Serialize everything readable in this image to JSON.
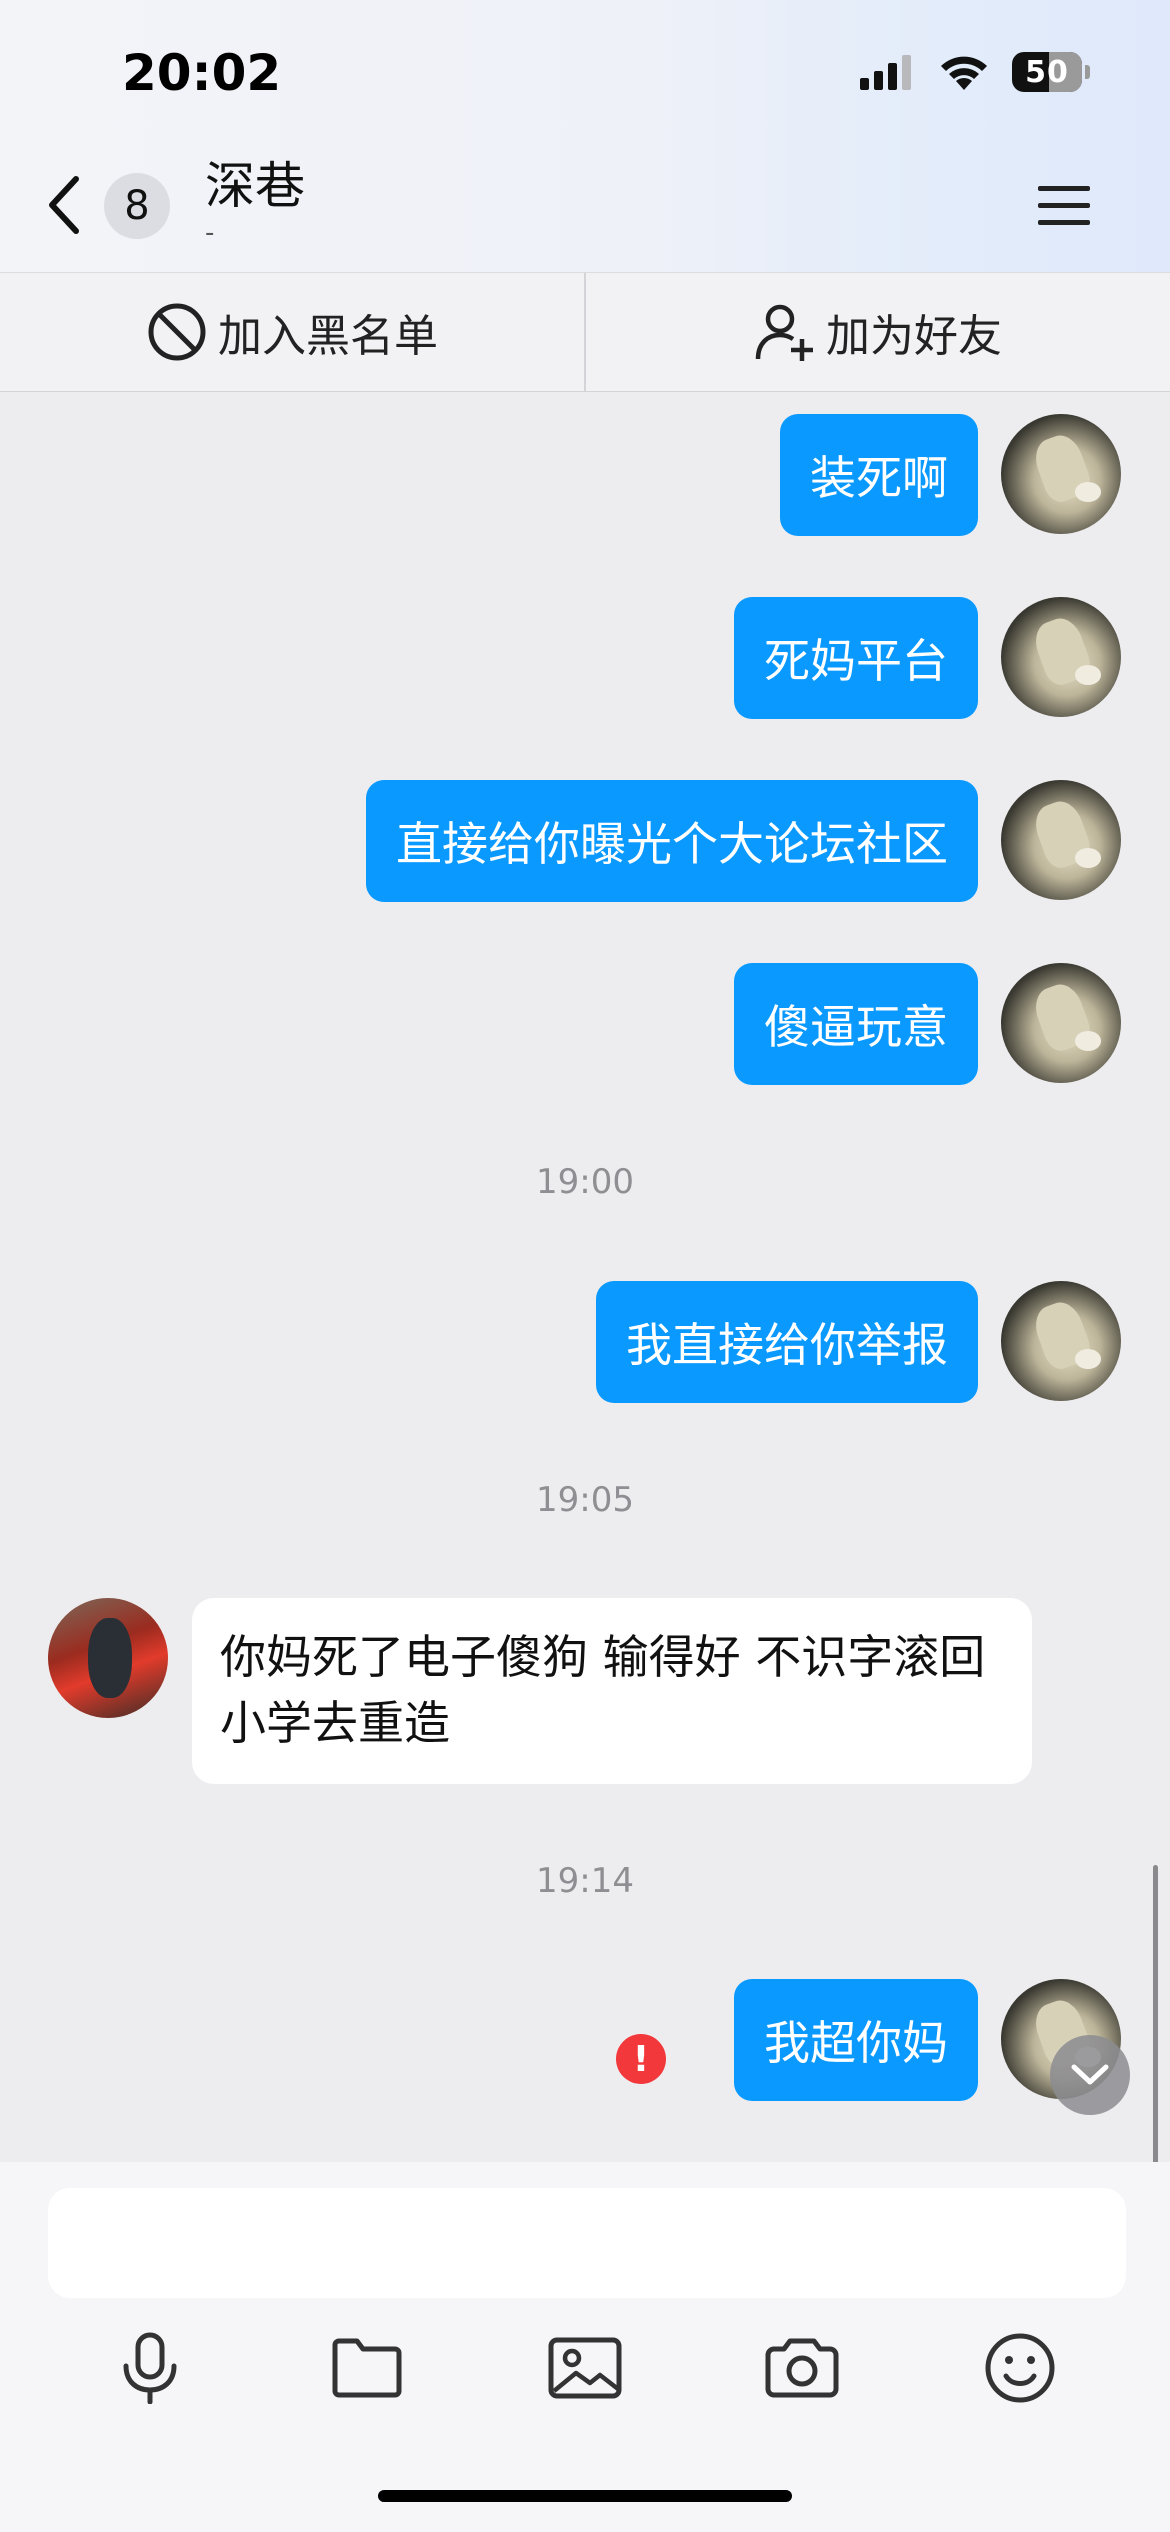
{
  "status_bar": {
    "time": "20:02",
    "battery": "50"
  },
  "header": {
    "back_badge_count": "8",
    "chat_name": "深巷",
    "chat_subtitle": "-"
  },
  "actions": {
    "block": "加入黑名单",
    "add_friend": "加为好友"
  },
  "messages": [
    {
      "type": "out",
      "text": "装死啊"
    },
    {
      "type": "out",
      "text": "死妈平台"
    },
    {
      "type": "out",
      "text": "直接给你曝光个大论坛社区"
    },
    {
      "type": "out",
      "text": "傻逼玩意"
    },
    {
      "type": "time",
      "text": "19:00"
    },
    {
      "type": "out",
      "text": "我直接给你举报"
    },
    {
      "type": "time",
      "text": "19:05"
    },
    {
      "type": "in",
      "text": "你妈死了电子傻狗 输得好 不识字滚回小学去重造"
    },
    {
      "type": "time",
      "text": "19:14"
    },
    {
      "type": "out",
      "text": "我超你妈",
      "failed": true
    }
  ],
  "colors": {
    "outgoing_bubble": "#0a99ff",
    "incoming_bubble": "#ffffff",
    "error": "#f2383b",
    "background": "#ededf0"
  },
  "icons": [
    "back-chevron-icon",
    "menu-icon",
    "block-icon",
    "add-user-icon",
    "error-icon",
    "chevron-down-icon",
    "microphone-icon",
    "folder-icon",
    "image-icon",
    "camera-icon",
    "emoji-icon"
  ]
}
